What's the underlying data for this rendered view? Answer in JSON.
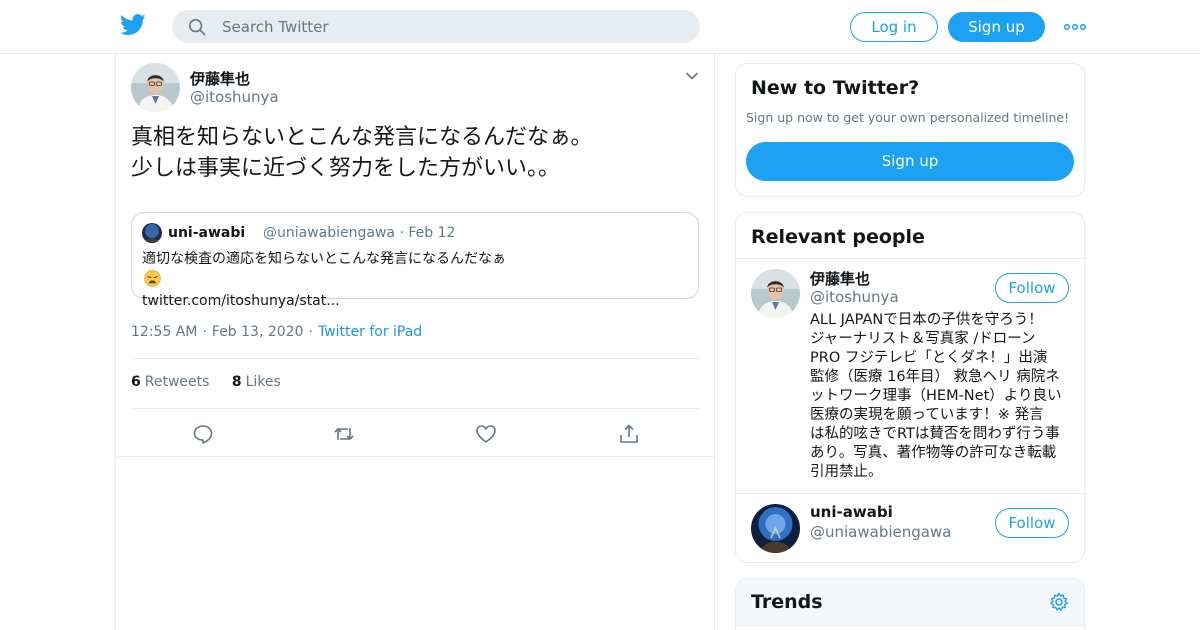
{
  "header": {
    "logo_icon": "twitter-bird-icon",
    "search_placeholder": "Search Twitter",
    "login_label": "Log in",
    "signup_label": "Sign up",
    "more_icon": "more-dots-icon",
    "brand_color": "#1da1f2"
  },
  "tweet": {
    "author_name": "伊藤隼也",
    "author_handle": "@itoshunya",
    "text_lines": [
      "真相を知らないとこんな発言になるんだなぁ。",
      "少しは事実に近づく努力をした方がいい。。"
    ],
    "quoted": {
      "author_name": "uni-awabi",
      "author_handle": "@uniawabiengawa",
      "separator": "·",
      "date": "Feb 12",
      "text_lines": [
        "適切な検査の適応を知らないとこんな発言になるんだなぁ",
        "twitter.com/itoshunya/stat..."
      ],
      "emoji": "weary-face-emoji"
    },
    "time": "12:55 AM",
    "date": "Feb 13, 2020",
    "separator": "·",
    "source": "Twitter for iPad",
    "retweet_count": "6",
    "retweet_label": "Retweets",
    "like_count": "8",
    "like_label": "Likes",
    "actions": [
      "reply-icon",
      "retweet-icon",
      "like-icon",
      "share-icon"
    ]
  },
  "sidebar": {
    "new_to_twitter": {
      "title": "New to Twitter?",
      "subtitle": "Sign up now to get your own personalized timeline!",
      "button": "Sign up"
    },
    "relevant_people": {
      "title": "Relevant people",
      "people": [
        {
          "name": "伊藤隼也",
          "handle": "@itoshunya",
          "follow_label": "Follow",
          "bio_lines": [
            "ALL JAPANで日本の子供を守ろう！",
            "ジャーナリスト＆写真家 /ドローン",
            "PRO フジテレビ「とくダネ！」出演",
            "監修（医療 16年目） 救急ヘリ 病院ネ",
            "ットワーク理事（HEM-Net）より良い",
            "医療の実現を願っています！※ 発言",
            "は私的呟きでRTは賛否を問わず行う事",
            "あり。写真、著作物等の許可なき転載",
            "引用禁止。"
          ]
        },
        {
          "name": "uni-awabi",
          "handle": "@uniawabiengawa",
          "follow_label": "Follow"
        }
      ]
    },
    "trends": {
      "title": "Trends",
      "settings_icon": "gear-icon"
    }
  }
}
